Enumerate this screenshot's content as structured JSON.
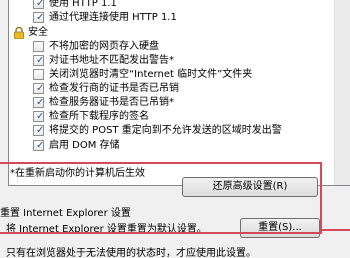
{
  "options": [
    {
      "type": "checkbox",
      "checked": true,
      "label": "使用 HTTP 1.1"
    },
    {
      "type": "checkbox",
      "checked": true,
      "label": "通过代理连接使用 HTTP 1.1"
    },
    {
      "type": "header",
      "icon": "lock-icon",
      "label": "安全"
    },
    {
      "type": "checkbox",
      "checked": false,
      "label": "不将加密的网页存入硬盘"
    },
    {
      "type": "checkbox",
      "checked": true,
      "label": "对证书地址不匹配发出警告*"
    },
    {
      "type": "checkbox",
      "checked": false,
      "label": "关闭浏览器时清空“Internet 临时文件”文件夹"
    },
    {
      "type": "checkbox",
      "checked": true,
      "label": "检查发行商的证书是否已吊销"
    },
    {
      "type": "checkbox",
      "checked": true,
      "label": "检查服务器证书是否已吊销*"
    },
    {
      "type": "checkbox",
      "checked": true,
      "label": "检查所下载程序的签名"
    },
    {
      "type": "checkbox",
      "checked": true,
      "label": "将提交的 POST 重定向到不允许发送的区域时发出警"
    },
    {
      "type": "checkbox",
      "checked": true,
      "label": "启用 DOM 存储"
    }
  ],
  "restart_note": "*在重新启动你的计算机后生效",
  "restore_button": "还原高级设置(R)",
  "reset_title": "重置 Internet Explorer 设置",
  "reset_desc": "将 Internet Explorer 设置重置为默认设置。",
  "reset_button": "重置(S)...",
  "bottom_note": "只有在浏览器处于无法使用的状态时，才应使用此设置。",
  "colors": {
    "highlight_frame": "#d44a5c",
    "checkmark": "#2b4f8d"
  }
}
